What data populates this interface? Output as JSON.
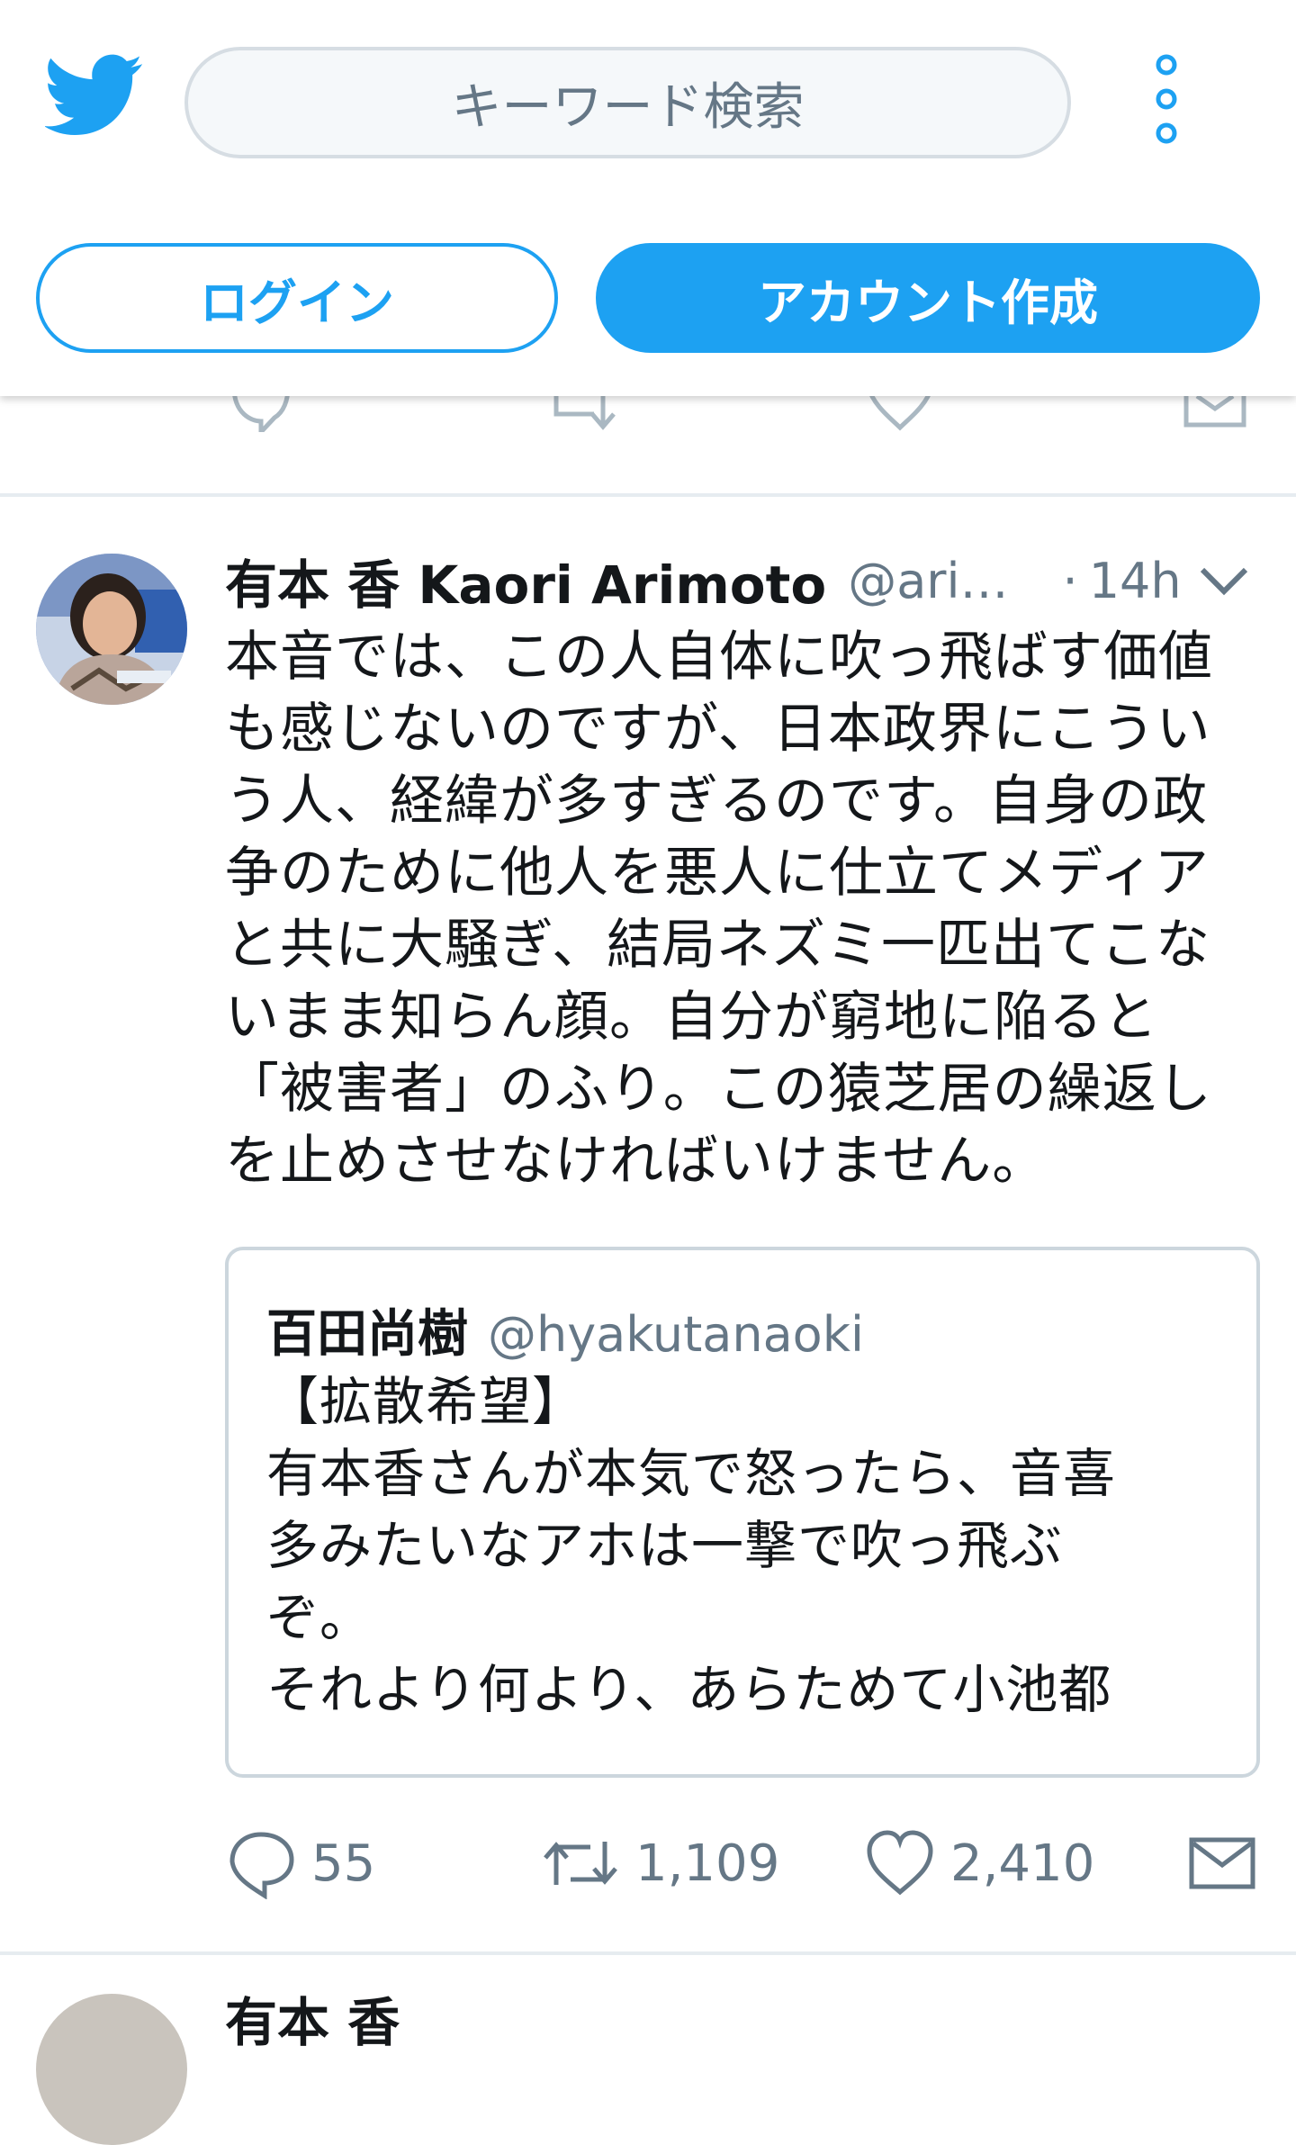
{
  "header": {
    "search_placeholder": "キーワード検索",
    "login_label": "ログイン",
    "signup_label": "アカウント作成",
    "brand_color": "#1da1f2"
  },
  "tweet": {
    "author_name": "有本 香 Kaori Arimoto",
    "handle": "@ari…",
    "separator": "·",
    "time": "14h",
    "text": "本音では、この人自体に吹っ飛ばす価値\nも感じないのですが、日本政界にこうい\nう人、経緯が多すぎるのです。自身の政\n争のために他人を悪人に仕立てメディア\nと共に大騒ぎ、結局ネズミ一匹出てこな\nいまま知らん顔。自分が窮地に陥ると\n「被害者」のふり。この猿芝居の繰返し\nを止めさせなければいけません。",
    "quote": {
      "author_name": "百田尚樹",
      "handle": "@hyakutanaoki",
      "text": "【拡散希望】\n有本香さんが本気で怒ったら、音喜\n多みたいなアホは一撃で吹っ飛ぶ\nぞ。\nそれより何より、あらためて小池都"
    },
    "actions": {
      "reply_count": "55",
      "retweet_count": "1,109",
      "like_count": "2,410"
    }
  },
  "next_tweet": {
    "author_name_partial": "有本 香"
  },
  "icons": [
    "twitter-bird-icon",
    "more-vertical-icon",
    "reply-icon",
    "retweet-icon",
    "like-icon",
    "dm-icon",
    "chevron-down-icon"
  ]
}
